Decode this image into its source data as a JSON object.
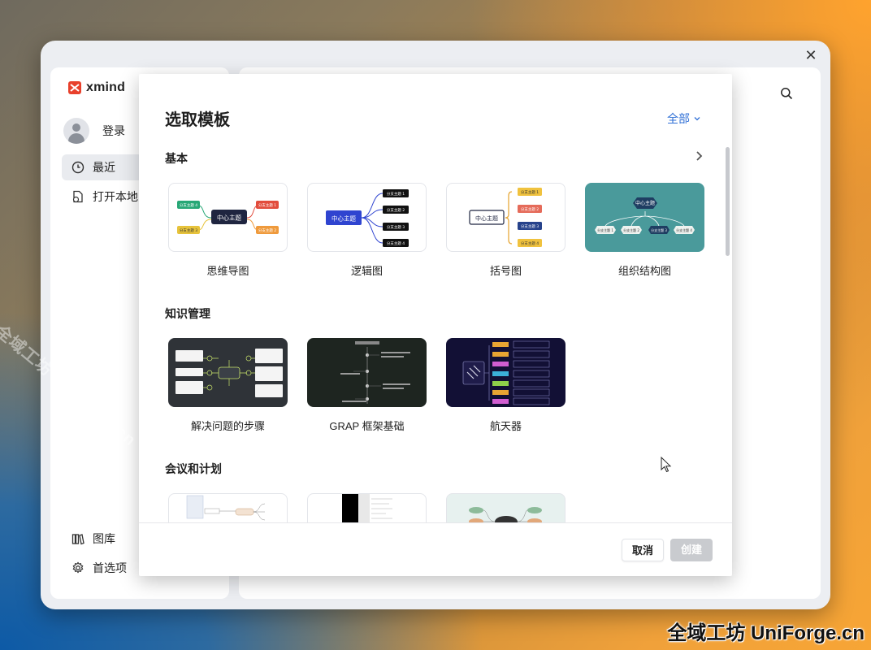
{
  "watermarks": {
    "diagonal": "全域工坊 UniForge.cn",
    "corner": "全域工坊 UniForge.cn"
  },
  "app": {
    "logo_text": "xmind",
    "login": "登录",
    "nav": {
      "recent": "最近",
      "open_local": "打开本地",
      "library": "图库",
      "preferences": "首选项"
    }
  },
  "dialog": {
    "title": "选取模板",
    "filter_label": "全部",
    "sections": [
      {
        "title": "基本",
        "cards": [
          {
            "label": "思维导图",
            "center": "中心主题",
            "branches": [
              "分支主题 1",
              "分支主题 2",
              "分支主题 3",
              "分支主题 4"
            ]
          },
          {
            "label": "逻辑图",
            "center": "中心主题",
            "branches": [
              "分支主题 1",
              "分支主题 2",
              "分支主题 3",
              "分支主题 4"
            ]
          },
          {
            "label": "括号图",
            "center": "中心主题",
            "branches": [
              "分支主题 1",
              "分支主题 2",
              "分支主题 3",
              "分支主题 4"
            ]
          },
          {
            "label": "组织结构图",
            "center": "中心主题",
            "branches": [
              "分支主题 1",
              "分支主题 2",
              "分支主题 3",
              "分支主题 4"
            ]
          }
        ]
      },
      {
        "title": "知识管理",
        "cards": [
          {
            "label": "解决问题的步骤"
          },
          {
            "label": "GRAP 框架基础"
          },
          {
            "label": "航天器"
          }
        ]
      },
      {
        "title": "会议和计划",
        "cards": [
          {
            "label": ""
          },
          {
            "label": ""
          },
          {
            "label": ""
          }
        ]
      }
    ],
    "buttons": {
      "cancel": "取消",
      "create": "创建"
    }
  },
  "colors": {
    "accent": "#2f6fd6",
    "mindmap_dark": "#1f2540",
    "org_teal": "#4a9a9b",
    "problem_bg": "#2f3338",
    "grap_bg": "#1e2520",
    "space_bg": "#121035"
  }
}
